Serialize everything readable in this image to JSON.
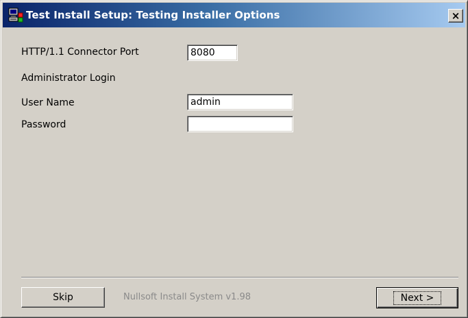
{
  "window": {
    "title": "Test Install Setup: Testing Installer Options",
    "close_glyph": "×"
  },
  "form": {
    "port_label": "HTTP/1.1 Connector Port",
    "port_value": "8080",
    "admin_section_label": "Administrator Login",
    "username_label": "User Name",
    "username_value": "admin",
    "password_label": "Password",
    "password_value": ""
  },
  "footer": {
    "skip_label": "Skip",
    "branding": "Nullsoft Install System v1.98",
    "next_label": "Next >"
  },
  "colors": {
    "face": "#d4d0c8",
    "title_start": "#0a246a",
    "title_end": "#a6caf0",
    "branding_text": "#8a8a8a"
  },
  "icons": {
    "app": "installer-computer-icon",
    "close": "close-icon"
  }
}
